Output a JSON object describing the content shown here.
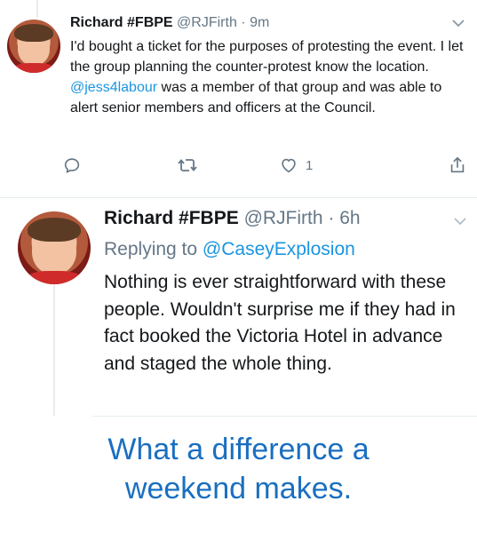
{
  "tweet1": {
    "name": "Richard #FBPE",
    "handle": "@RJFirth",
    "separator": "·",
    "time": "9m",
    "text_before": "I'd bought a ticket for the purposes of protesting the event. I let the group planning the counter-protest know the location. ",
    "mention": "@jess4labour",
    "text_after": " was a member of that group and was able to alert senior members and officers at the Council.",
    "like_count": "1",
    "icons": [
      "reply-icon",
      "retweet-icon",
      "like-icon",
      "share-icon",
      "chevron-down-icon"
    ]
  },
  "tweet2": {
    "name": "Richard #FBPE",
    "handle": "@RJFirth",
    "separator": "·",
    "time": "6h",
    "replying_prefix": "Replying to ",
    "replying_to": "@CaseyExplosion",
    "text": "Nothing is ever straightforward with these people. Wouldn't surprise me if they had in fact booked the Victoria Hotel in advance and staged the whole thing."
  },
  "caption": {
    "line1": "What a difference a",
    "line2": "weekend makes."
  },
  "colors": {
    "link": "#1b95e0",
    "secondary": "#657786",
    "caption": "#1a6fc0"
  }
}
